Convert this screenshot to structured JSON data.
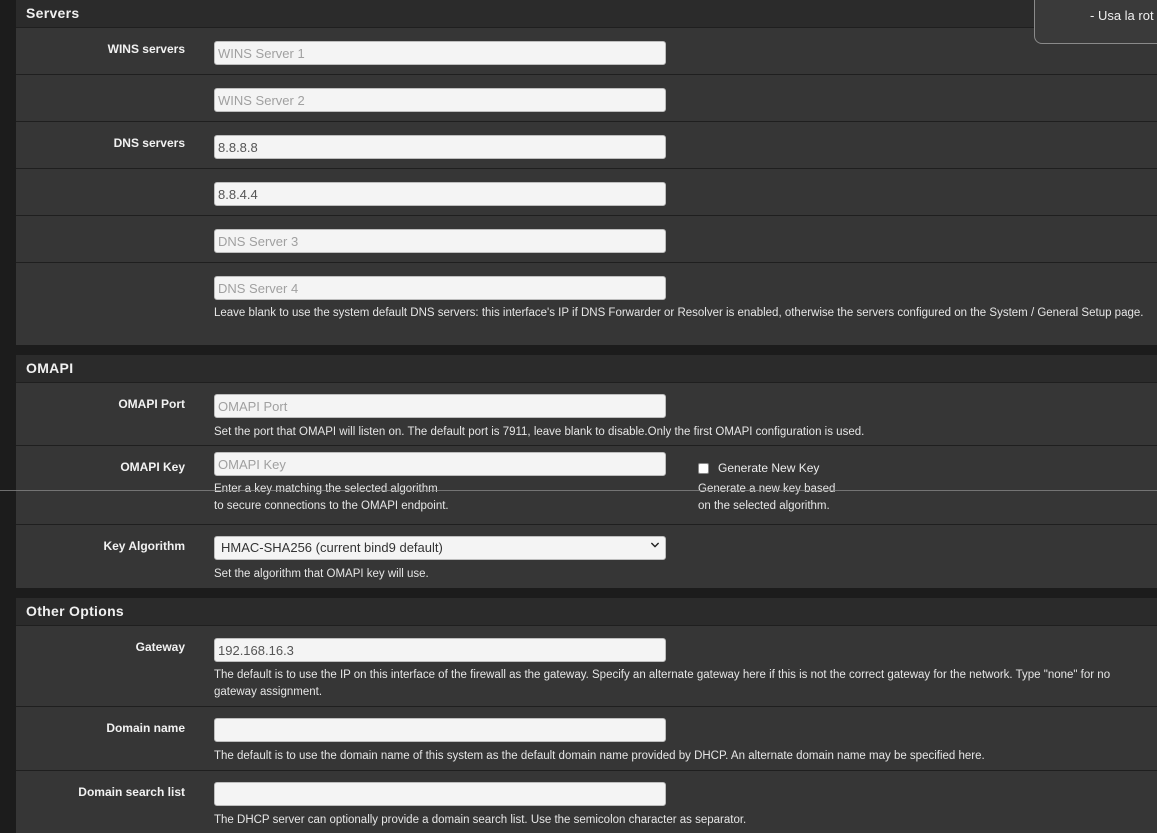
{
  "tooltip": {
    "line1": "- Usa la rot"
  },
  "servers": {
    "heading": "Servers",
    "wins_label": "WINS servers",
    "wins1_placeholder": "WINS Server 1",
    "wins2_placeholder": "WINS Server 2",
    "dns_label": "DNS servers",
    "dns1_value": "8.8.8.8",
    "dns2_value": "8.8.4.4",
    "dns3_placeholder": "DNS Server 3",
    "dns4_placeholder": "DNS Server 4",
    "dns_help": "Leave blank to use the system default DNS servers: this interface's IP if DNS Forwarder or Resolver is enabled, otherwise the servers configured on the System / General Setup page."
  },
  "omapi": {
    "heading": "OMAPI",
    "port_label": "OMAPI Port",
    "port_placeholder": "OMAPI Port",
    "port_help": "Set the port that OMAPI will listen on. The default port is 7911, leave blank to disable.Only the first OMAPI configuration is used.",
    "key_label": "OMAPI Key",
    "key_placeholder": "OMAPI Key",
    "key_help_line1": "Enter a key matching the selected algorithm",
    "key_help_line2": "to secure connections to the OMAPI endpoint.",
    "generate_label": "Generate New Key",
    "generate_checked": false,
    "generate_help_line1": "Generate a new key based",
    "generate_help_line2": "on the selected algorithm.",
    "algo_label": "Key Algorithm",
    "algo_selected": "HMAC-SHA256 (current bind9 default)",
    "algo_help": "Set the algorithm that OMAPI key will use."
  },
  "other": {
    "heading": "Other Options",
    "gateway_label": "Gateway",
    "gateway_value": "192.168.16.3",
    "gateway_help": "The default is to use the IP on this interface of the firewall as the gateway. Specify an alternate gateway here if this is not the correct gateway for the network. Type \"none\" for no gateway assignment.",
    "domain_label": "Domain name",
    "domain_value": "",
    "domain_help": "The default is to use the domain name of this system as the default domain name provided by DHCP. An alternate domain name may be specified here.",
    "search_label": "Domain search list",
    "search_value": "",
    "search_help": "The DHCP server can optionally provide a domain search list. Use the semicolon character as separator."
  },
  "colors": {
    "page_bg": "#1c1c1c",
    "panel_bg": "#363636",
    "heading_bg": "#2b2b2b",
    "input_bg": "#f4f4f4"
  }
}
